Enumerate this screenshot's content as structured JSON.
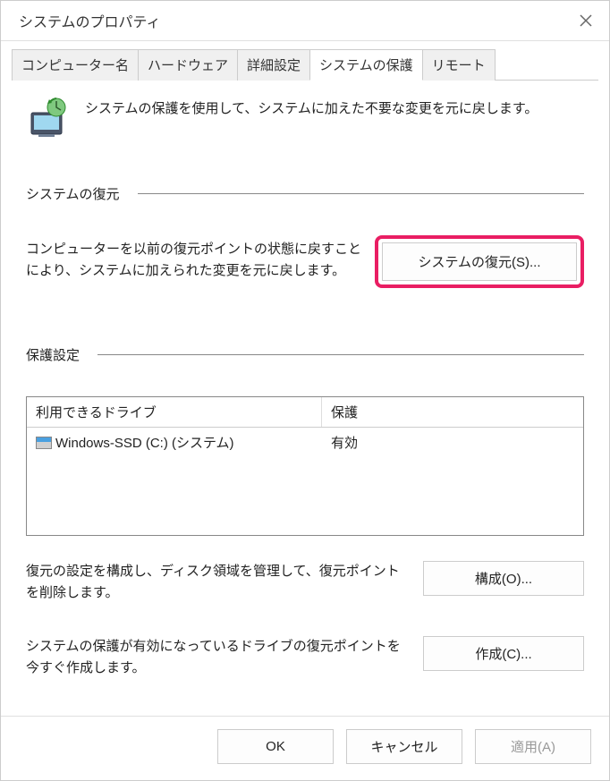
{
  "window": {
    "title": "システムのプロパティ"
  },
  "tabs": {
    "computer_name": "コンピューター名",
    "hardware": "ハードウェア",
    "advanced": "詳細設定",
    "system_protection": "システムの保護",
    "remote": "リモート"
  },
  "intro": {
    "text": "システムの保護を使用して、システムに加えた不要な変更を元に戻します。"
  },
  "restore_section": {
    "title": "システムの復元",
    "description": "コンピューターを以前の復元ポイントの状態に戻すことにより、システムに加えられた変更を元に戻します。",
    "button": "システムの復元(S)..."
  },
  "protection_section": {
    "title": "保護設定",
    "columns": {
      "drive": "利用できるドライブ",
      "protection": "保護"
    },
    "drives": [
      {
        "name": "Windows-SSD (C:) (システム)",
        "protection": "有効"
      }
    ],
    "configure": {
      "description": "復元の設定を構成し、ディスク領域を管理して、復元ポイントを削除します。",
      "button": "構成(O)..."
    },
    "create": {
      "description": "システムの保護が有効になっているドライブの復元ポイントを今すぐ作成します。",
      "button": "作成(C)..."
    }
  },
  "footer": {
    "ok": "OK",
    "cancel": "キャンセル",
    "apply": "適用(A)"
  }
}
